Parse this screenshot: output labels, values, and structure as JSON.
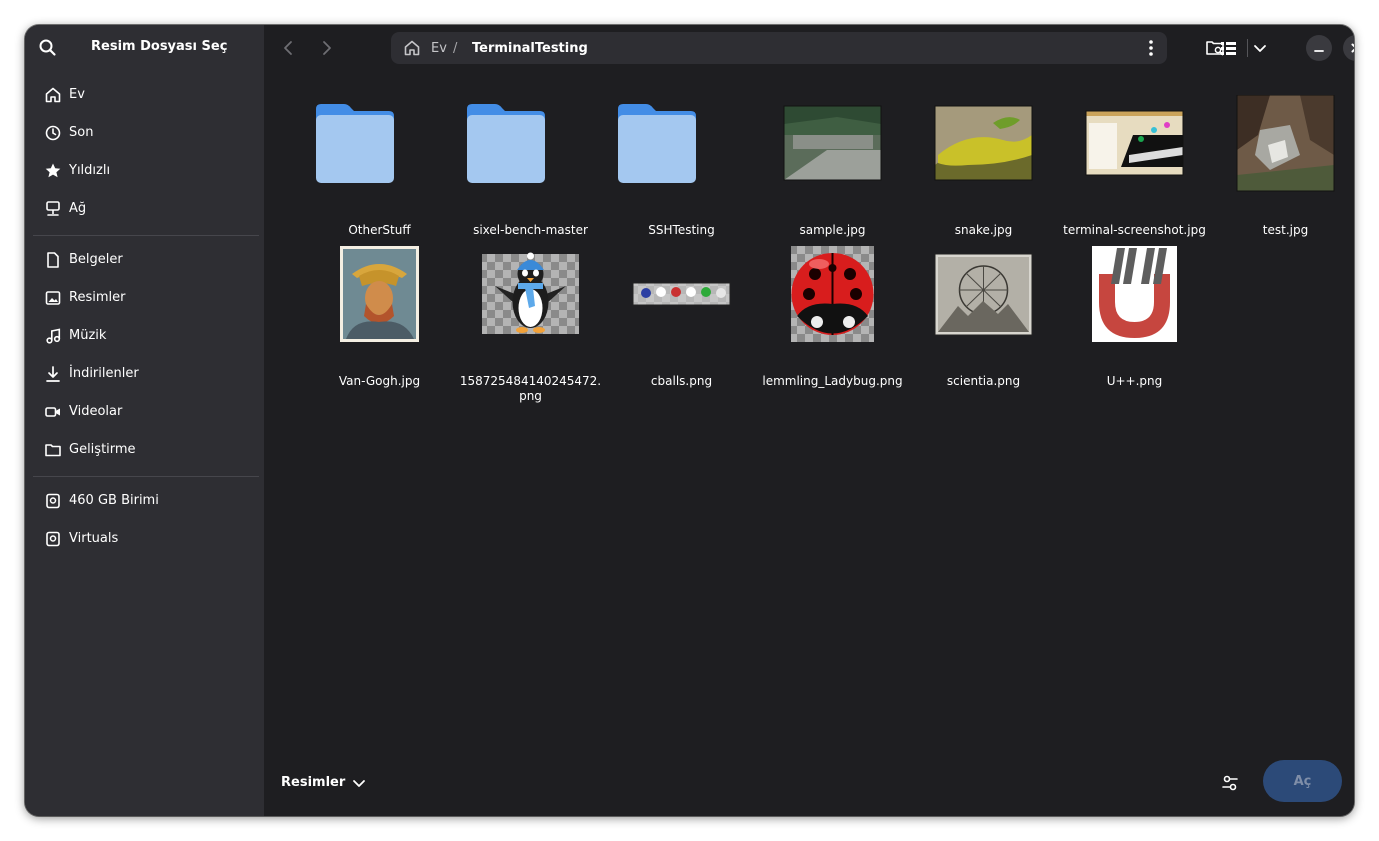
{
  "sidebar": {
    "title": "Resim Dosyası Seç",
    "places": [
      {
        "label": "Ev",
        "icon": "home-icon"
      },
      {
        "label": "Son",
        "icon": "clock-icon"
      },
      {
        "label": "Yıldızlı",
        "icon": "star-icon"
      },
      {
        "label": "Ağ",
        "icon": "network-icon"
      }
    ],
    "bookmarks": [
      {
        "label": "Belgeler",
        "icon": "document-icon"
      },
      {
        "label": "Resimler",
        "icon": "image-icon"
      },
      {
        "label": "Müzik",
        "icon": "music-icon"
      },
      {
        "label": "İndirilenler",
        "icon": "download-icon"
      },
      {
        "label": "Videolar",
        "icon": "video-icon"
      },
      {
        "label": "Geliştirme",
        "icon": "folder-icon"
      }
    ],
    "volumes": [
      {
        "label": "460 GB Birimi",
        "icon": "drive-icon"
      },
      {
        "label": "Virtuals",
        "icon": "drive-icon"
      }
    ]
  },
  "header": {
    "breadcrumb": {
      "home": "Ev",
      "separator": "/",
      "current": "TerminalTesting"
    }
  },
  "files": [
    {
      "name": "OtherStuff",
      "kind": "folder"
    },
    {
      "name": "sixel-bench-master",
      "kind": "folder"
    },
    {
      "name": "SSHTesting",
      "kind": "folder"
    },
    {
      "name": "sample.jpg",
      "kind": "image"
    },
    {
      "name": "snake.jpg",
      "kind": "image"
    },
    {
      "name": "terminal-screenshot.jpg",
      "kind": "image"
    },
    {
      "name": "test.jpg",
      "kind": "image"
    },
    {
      "name": "Van-Gogh.jpg",
      "kind": "image"
    },
    {
      "name": "158725484140245472.png",
      "kind": "image"
    },
    {
      "name": "cballs.png",
      "kind": "image"
    },
    {
      "name": "lemmling_Ladybug.png",
      "kind": "image"
    },
    {
      "name": "scientia.png",
      "kind": "image"
    },
    {
      "name": "U++.png",
      "kind": "image"
    }
  ],
  "footer": {
    "filter": "Resimler",
    "open_label": "Aç"
  },
  "colors": {
    "folder": "#a4c8f0",
    "folder_tab": "#438de6",
    "accent_disabled": "#2c4a78"
  }
}
